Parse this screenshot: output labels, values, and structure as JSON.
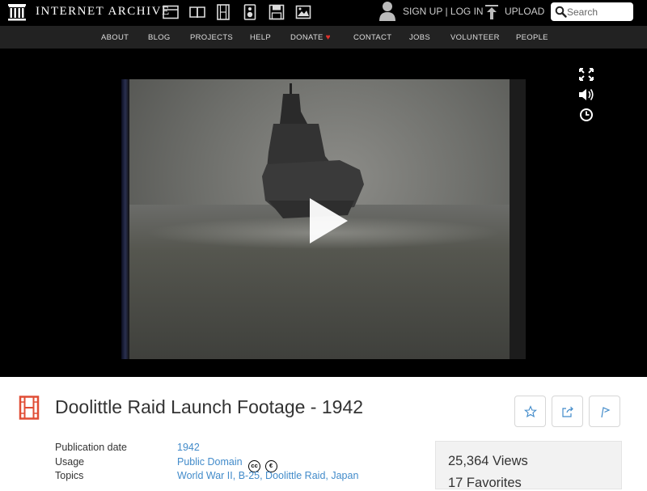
{
  "header": {
    "logo_text": "INTERNET ARCHIVE",
    "signup_text": "SIGN UP | LOG IN",
    "upload_text": "UPLOAD",
    "search_placeholder": "Search",
    "mediatypes": [
      "web-icon",
      "texts-icon",
      "video-icon",
      "audio-icon",
      "software-icon",
      "images-icon"
    ]
  },
  "nav": {
    "items": [
      "ABOUT",
      "BLOG",
      "PROJECTS",
      "HELP",
      "DONATE",
      "CONTACT",
      "JOBS",
      "VOLUNTEER",
      "PEOPLE"
    ]
  },
  "player": {
    "controls": [
      "fullscreen-icon",
      "volume-icon",
      "clock-icon",
      "play-icon"
    ]
  },
  "item": {
    "title": "Doolittle Raid Launch Footage - 1942",
    "actions": [
      "favorite-star-icon",
      "share-icon",
      "flag-icon"
    ]
  },
  "metadata": {
    "publication_date_label": "Publication date",
    "publication_date": "1942",
    "usage_label": "Usage",
    "usage": "Public Domain",
    "topics_label": "Topics",
    "topics": "World War II, B-25, Doolittle Raid, Japan"
  },
  "stats": {
    "views": "25,364 Views",
    "favorites": "17 Favorites"
  },
  "colors": {
    "link": "#428bca",
    "accent_icon": "#e04d35",
    "topbar": "#000000",
    "navbar": "#222222"
  }
}
